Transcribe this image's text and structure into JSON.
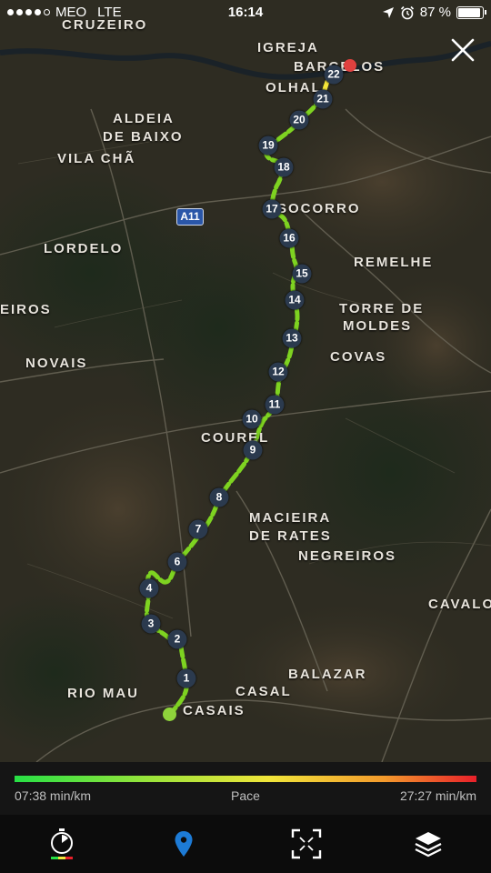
{
  "status_bar": {
    "carrier": "MEO",
    "network": "LTE",
    "time": "16:14",
    "battery": "87 %",
    "battery_level": 0.87
  },
  "map": {
    "places": [
      {
        "id": "cruzeiro",
        "label": "Cruzeiro"
      },
      {
        "id": "igreja",
        "label": "Igreja"
      },
      {
        "id": "barcelos",
        "label": "Barcelos"
      },
      {
        "id": "olhal",
        "label": "Olhal"
      },
      {
        "id": "aldeia",
        "label": "Aldeia"
      },
      {
        "id": "de-baixo",
        "label": "de Baixo"
      },
      {
        "id": "vila-cha",
        "label": "Vila Chã"
      },
      {
        "id": "socorro",
        "label": "Socorro"
      },
      {
        "id": "lordelo",
        "label": "Lordelo"
      },
      {
        "id": "remelhe",
        "label": "Remelhe"
      },
      {
        "id": "eiros",
        "label": "eiros"
      },
      {
        "id": "torre-de",
        "label": "Torre de"
      },
      {
        "id": "moldes",
        "label": "Moldes"
      },
      {
        "id": "covas",
        "label": "Covas"
      },
      {
        "id": "novais",
        "label": "Novais"
      },
      {
        "id": "courel",
        "label": "Courel"
      },
      {
        "id": "macieira",
        "label": "Macieira"
      },
      {
        "id": "de-rates",
        "label": "de Rates"
      },
      {
        "id": "negreiros",
        "label": "Negreiros"
      },
      {
        "id": "cavalo",
        "label": "Cavalo"
      },
      {
        "id": "balazar",
        "label": "Balazar"
      },
      {
        "id": "rio-mau",
        "label": "Rio Mau"
      },
      {
        "id": "casal",
        "label": "Casal"
      },
      {
        "id": "casais",
        "label": "Casais"
      }
    ],
    "highway_label": "A11",
    "km_markers": [
      "1",
      "2",
      "3",
      "4",
      "6",
      "7",
      "8",
      "9",
      "10",
      "11",
      "12",
      "13",
      "14",
      "15",
      "16",
      "17",
      "18",
      "19",
      "20",
      "21",
      "22"
    ],
    "route_color_fast": "#7ed321",
    "route_color_slow": "#f5e53a",
    "end_marker_color": "#e0413f"
  },
  "pace": {
    "min_label": "07:38 min/km",
    "title": "Pace",
    "max_label": "27:27 min/km"
  },
  "tabs": [
    {
      "id": "stopwatch",
      "icon": "stopwatch-icon",
      "active": false
    },
    {
      "id": "map",
      "icon": "map-pin-icon",
      "active": true
    },
    {
      "id": "expand",
      "icon": "expand-icon",
      "active": false
    },
    {
      "id": "layers",
      "icon": "layers-icon",
      "active": false
    }
  ]
}
